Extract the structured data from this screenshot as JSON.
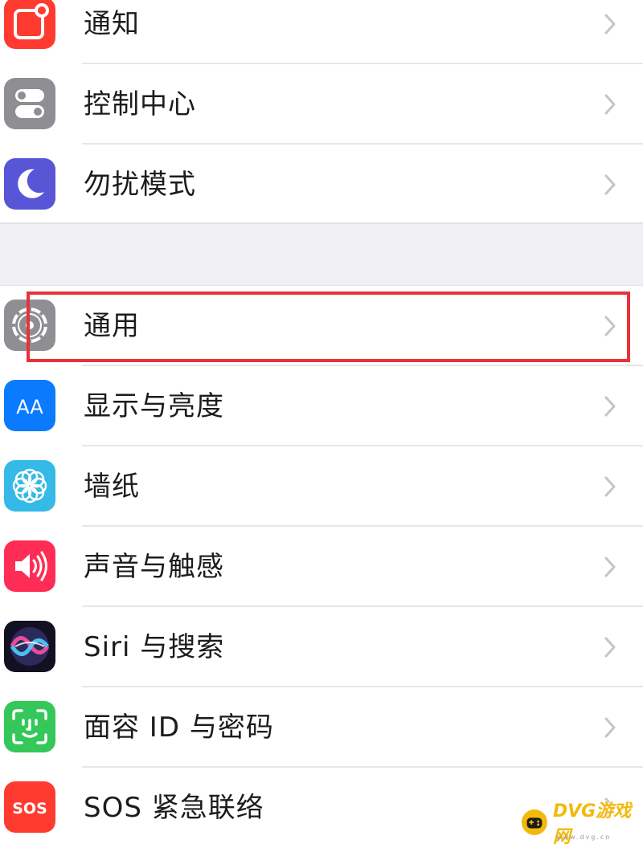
{
  "settings": {
    "group1": [
      {
        "label": "通知",
        "icon": "notifications-icon",
        "color": "#ff3b30"
      },
      {
        "label": "控制中心",
        "icon": "control-center-icon",
        "color": "#8e8e93"
      },
      {
        "label": "勿扰模式",
        "icon": "moon-icon",
        "color": "#5856d6"
      }
    ],
    "group2": [
      {
        "label": "通用",
        "icon": "gear-icon",
        "color": "#8e8e93"
      },
      {
        "label": "显示与亮度",
        "icon": "display-brightness-icon",
        "color": "#0a7aff"
      },
      {
        "label": "墙纸",
        "icon": "wallpaper-icon",
        "color": "#35b9e6"
      },
      {
        "label": "声音与触感",
        "icon": "sounds-icon",
        "color": "#ff2d55"
      },
      {
        "label": "Siri 与搜索",
        "icon": "siri-icon",
        "color": "#1c1c3a"
      },
      {
        "label": "面容 ID 与密码",
        "icon": "face-id-icon",
        "color": "#34c759"
      },
      {
        "label": "SOS 紧急联络",
        "icon": "sos-icon",
        "color": "#ff3b30"
      }
    ]
  },
  "icon_texts": {
    "display": "AA",
    "sos": "SOS"
  },
  "highlight": {
    "target": "通用",
    "color": "#e8323a"
  },
  "watermark": {
    "text": "DVG游戏网",
    "sub": "www.dvg.cn",
    "color": "#f2b90c"
  }
}
